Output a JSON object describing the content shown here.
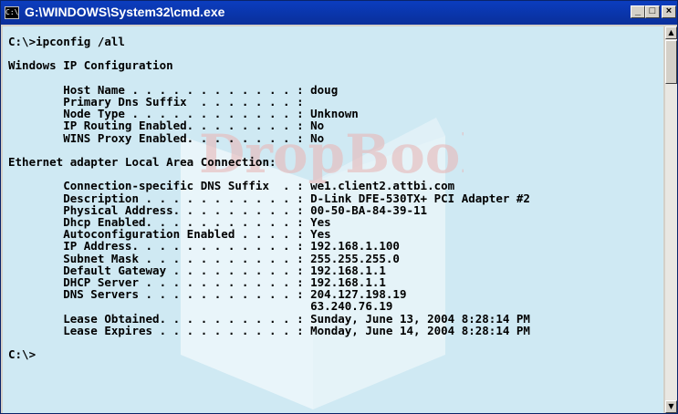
{
  "window": {
    "title": "G:\\WINDOWS\\System32\\cmd.exe",
    "icon_label": "C:\\",
    "minimize_glyph": "_",
    "maximize_glyph": "□",
    "close_glyph": "×"
  },
  "watermark": {
    "text": "DropBooks"
  },
  "console_lines": [
    "C:\\>ipconfig /all",
    "",
    "Windows IP Configuration",
    "",
    "        Host Name . . . . . . . . . . . . : doug",
    "        Primary Dns Suffix  . . . . . . . :",
    "        Node Type . . . . . . . . . . . . : Unknown",
    "        IP Routing Enabled. . . . . . . . : No",
    "        WINS Proxy Enabled. . . . . . . . : No",
    "",
    "Ethernet adapter Local Area Connection:",
    "",
    "        Connection-specific DNS Suffix  . : we1.client2.attbi.com",
    "        Description . . . . . . . . . . . : D-Link DFE-530TX+ PCI Adapter #2",
    "        Physical Address. . . . . . . . . : 00-50-BA-84-39-11",
    "        Dhcp Enabled. . . . . . . . . . . : Yes",
    "        Autoconfiguration Enabled . . . . : Yes",
    "        IP Address. . . . . . . . . . . . : 192.168.1.100",
    "        Subnet Mask . . . . . . . . . . . : 255.255.255.0",
    "        Default Gateway . . . . . . . . . : 192.168.1.1",
    "        DHCP Server . . . . . . . . . . . : 192.168.1.1",
    "        DNS Servers . . . . . . . . . . . : 204.127.198.19",
    "                                            63.240.76.19",
    "        Lease Obtained. . . . . . . . . . : Sunday, June 13, 2004 8:28:14 PM",
    "        Lease Expires . . . . . . . . . . : Monday, June 14, 2004 8:28:14 PM",
    "",
    "C:\\>"
  ],
  "scrollbar": {
    "up_glyph": "▲",
    "down_glyph": "▼"
  },
  "colors": {
    "titlebar": "#0a2f9a",
    "console_bg": "#cfe9f3",
    "text": "#000000"
  }
}
